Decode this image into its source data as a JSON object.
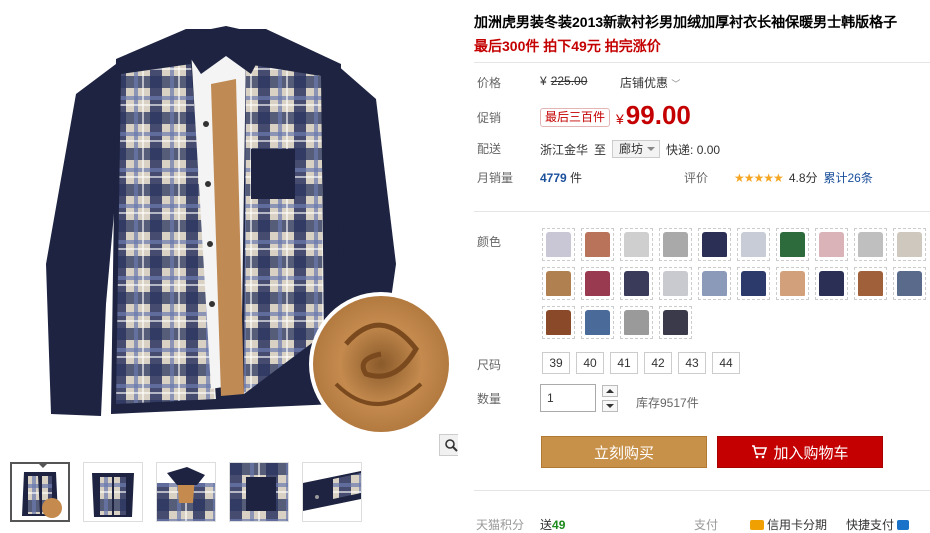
{
  "gallery": {
    "zoom_icon": "magnifier-icon",
    "thumbs": [
      {
        "name": "thumb-front-fleece",
        "active": true
      },
      {
        "name": "thumb-front",
        "active": false
      },
      {
        "name": "thumb-collar",
        "active": false
      },
      {
        "name": "thumb-pocket",
        "active": false
      },
      {
        "name": "thumb-cuff",
        "active": false
      }
    ]
  },
  "product": {
    "title": "加洲虎男装冬装2013新款衬衫男加绒加厚衬衣长袖保暖男士韩版格子",
    "promo_line": "最后300件 拍下49元 拍完涨价"
  },
  "price": {
    "label": "价格",
    "currency": "¥",
    "original": "225.00",
    "shop_promo": "店铺优惠"
  },
  "promo": {
    "label": "促销",
    "badge": "最后三百件",
    "currency": "¥",
    "price": "99.00"
  },
  "shipping": {
    "label": "配送",
    "from": "浙江金华",
    "to_word": "至",
    "to": "廊坊",
    "express": "快递: 0.00"
  },
  "sales": {
    "label": "月销量",
    "count": "4779",
    "unit": "件"
  },
  "review": {
    "label": "评价",
    "stars": "★★★★★",
    "score": "4.8分",
    "total": "累计26条"
  },
  "colors": {
    "label": "颜色",
    "swatches": [
      "#c9c7d6",
      "#b8735a",
      "#cfcfcf",
      "#a9a9a9",
      "#2b2f55",
      "#c7ccd6",
      "#2e6b3c",
      "#d9b3b8",
      "#bfbfbf",
      "#cfc8be",
      "#b08050",
      "#9a3a50",
      "#3a3a5a",
      "#c9c9d0",
      "#8a9ab8",
      "#2c3a6b",
      "#d2a07a",
      "#2b2f55",
      "#a0603a",
      "#5a6a8a",
      "#8a4a2a",
      "#4a6a9a",
      "#9a9a9a",
      "#3a3a4a"
    ]
  },
  "size": {
    "label": "尺码",
    "options": [
      "39",
      "40",
      "41",
      "42",
      "43",
      "44"
    ]
  },
  "quantity": {
    "label": "数量",
    "value": "1",
    "stock": "库存9517件"
  },
  "actions": {
    "buy_now": "立刻购买",
    "add_cart": "加入购物车"
  },
  "footer": {
    "points_label": "天猫积分",
    "points_prefix": "送",
    "points_value": "49",
    "pay_label": "支付",
    "credit_installment": "信用卡分期",
    "quick_pay": "快捷支付"
  }
}
